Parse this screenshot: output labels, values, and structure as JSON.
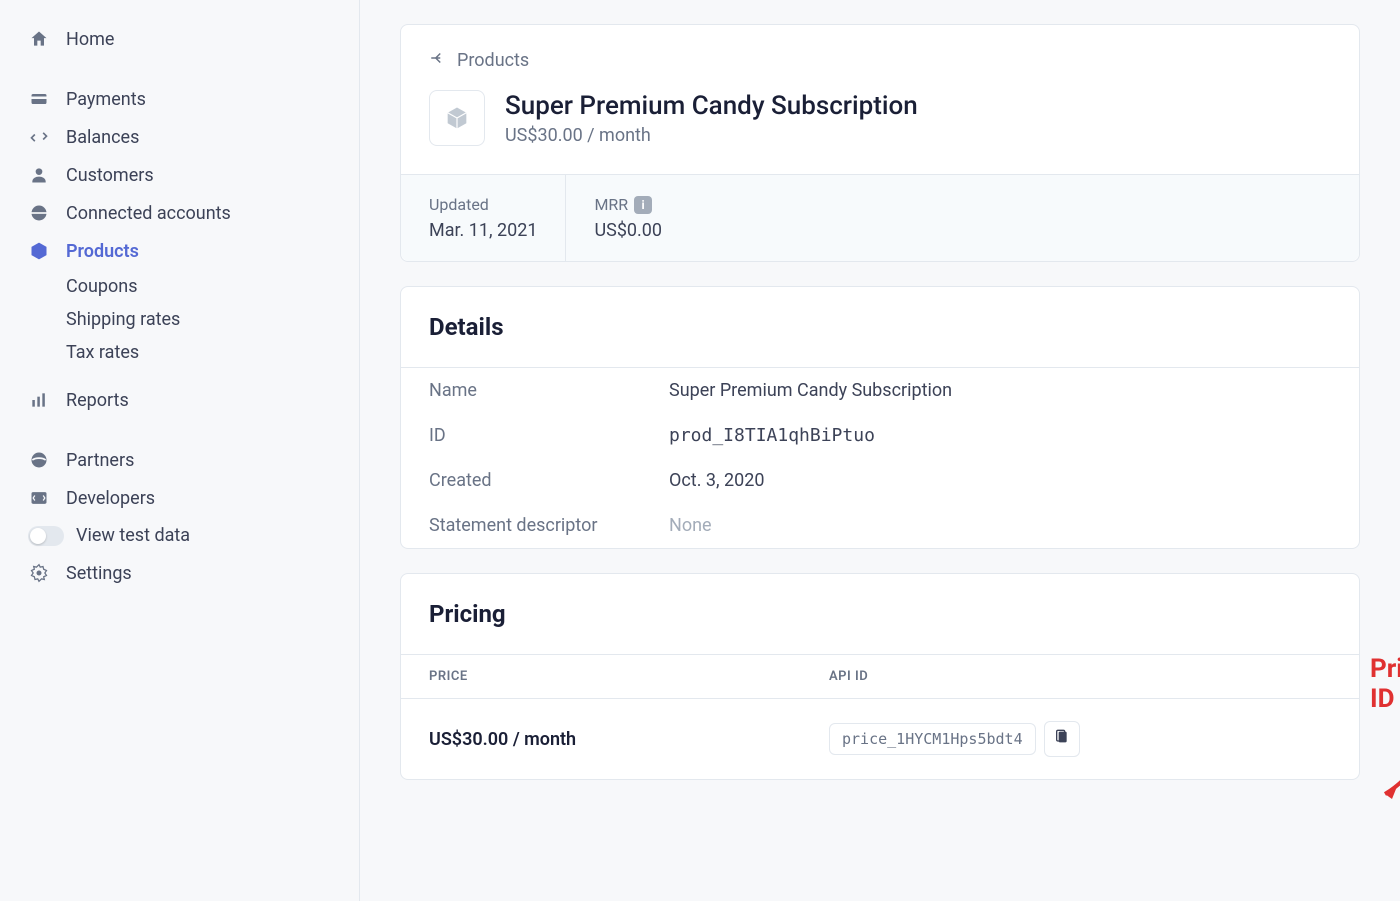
{
  "sidebar": {
    "home": "Home",
    "payments": "Payments",
    "balances": "Balances",
    "customers": "Customers",
    "connected": "Connected accounts",
    "products": "Products",
    "coupons": "Coupons",
    "shipping": "Shipping rates",
    "tax": "Tax rates",
    "reports": "Reports",
    "partners": "Partners",
    "developers": "Developers",
    "testdata": "View test data",
    "settings": "Settings"
  },
  "breadcrumb": {
    "back": "Products"
  },
  "product": {
    "name": "Super Premium Candy Subscription",
    "price_line": "US$30.00 / month"
  },
  "stats": {
    "updated_label": "Updated",
    "updated_value": "Mar. 11, 2021",
    "mrr_label": "MRR",
    "mrr_value": "US$0.00"
  },
  "details": {
    "title": "Details",
    "rows": {
      "name_label": "Name",
      "name_value": "Super Premium Candy Subscription",
      "id_label": "ID",
      "id_value": "prod_I8TIA1qhBiPtuo",
      "created_label": "Created",
      "created_value": "Oct. 3, 2020",
      "descriptor_label": "Statement descriptor",
      "descriptor_value": "None"
    }
  },
  "pricing": {
    "title": "Pricing",
    "col_price": "PRICE",
    "col_api": "API ID",
    "row_price": "US$30.00 / month",
    "row_api_id": "price_1HYCM1Hps5bdt4"
  },
  "annotation": {
    "label": "Price ID"
  }
}
